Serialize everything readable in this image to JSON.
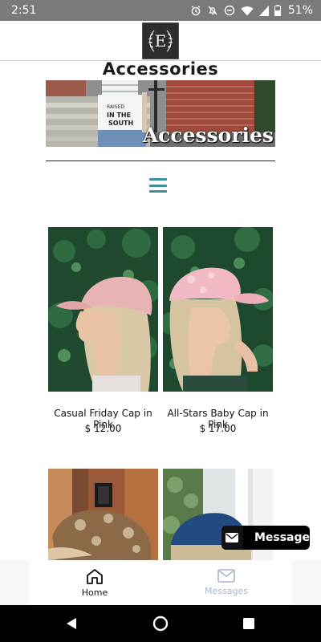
{
  "status_bar": {
    "time": "2:51",
    "battery": "51%",
    "icons": [
      "alarm-icon",
      "notifications-off-icon",
      "do-not-disturb-icon",
      "wifi-icon",
      "signal-icon",
      "battery-icon"
    ]
  },
  "header": {
    "logo_letter": "E"
  },
  "page": {
    "title": "Accessories"
  },
  "banner": {
    "text": "Accessories",
    "shirt_text_1": "RAISED",
    "shirt_text_2": "IN THE",
    "shirt_text_3": "SOUTH"
  },
  "products": [
    {
      "name": "Casual Friday Cap in Pink",
      "price": "$ 12.00"
    },
    {
      "name": "All-Stars Baby Cap in Pink",
      "price": "$ 17.00"
    },
    {
      "name": "",
      "price": ""
    },
    {
      "name": "",
      "price": ""
    }
  ],
  "message_button": {
    "label": "Message"
  },
  "tabs": [
    {
      "label": "Home",
      "icon": "home-icon",
      "active": true
    },
    {
      "label": "Messages",
      "icon": "mail-icon",
      "active": false
    }
  ],
  "colors": {
    "accent": "#3d8f96",
    "status_bar": "#7a7a7a",
    "inactive_tab": "#a9b6c7"
  }
}
